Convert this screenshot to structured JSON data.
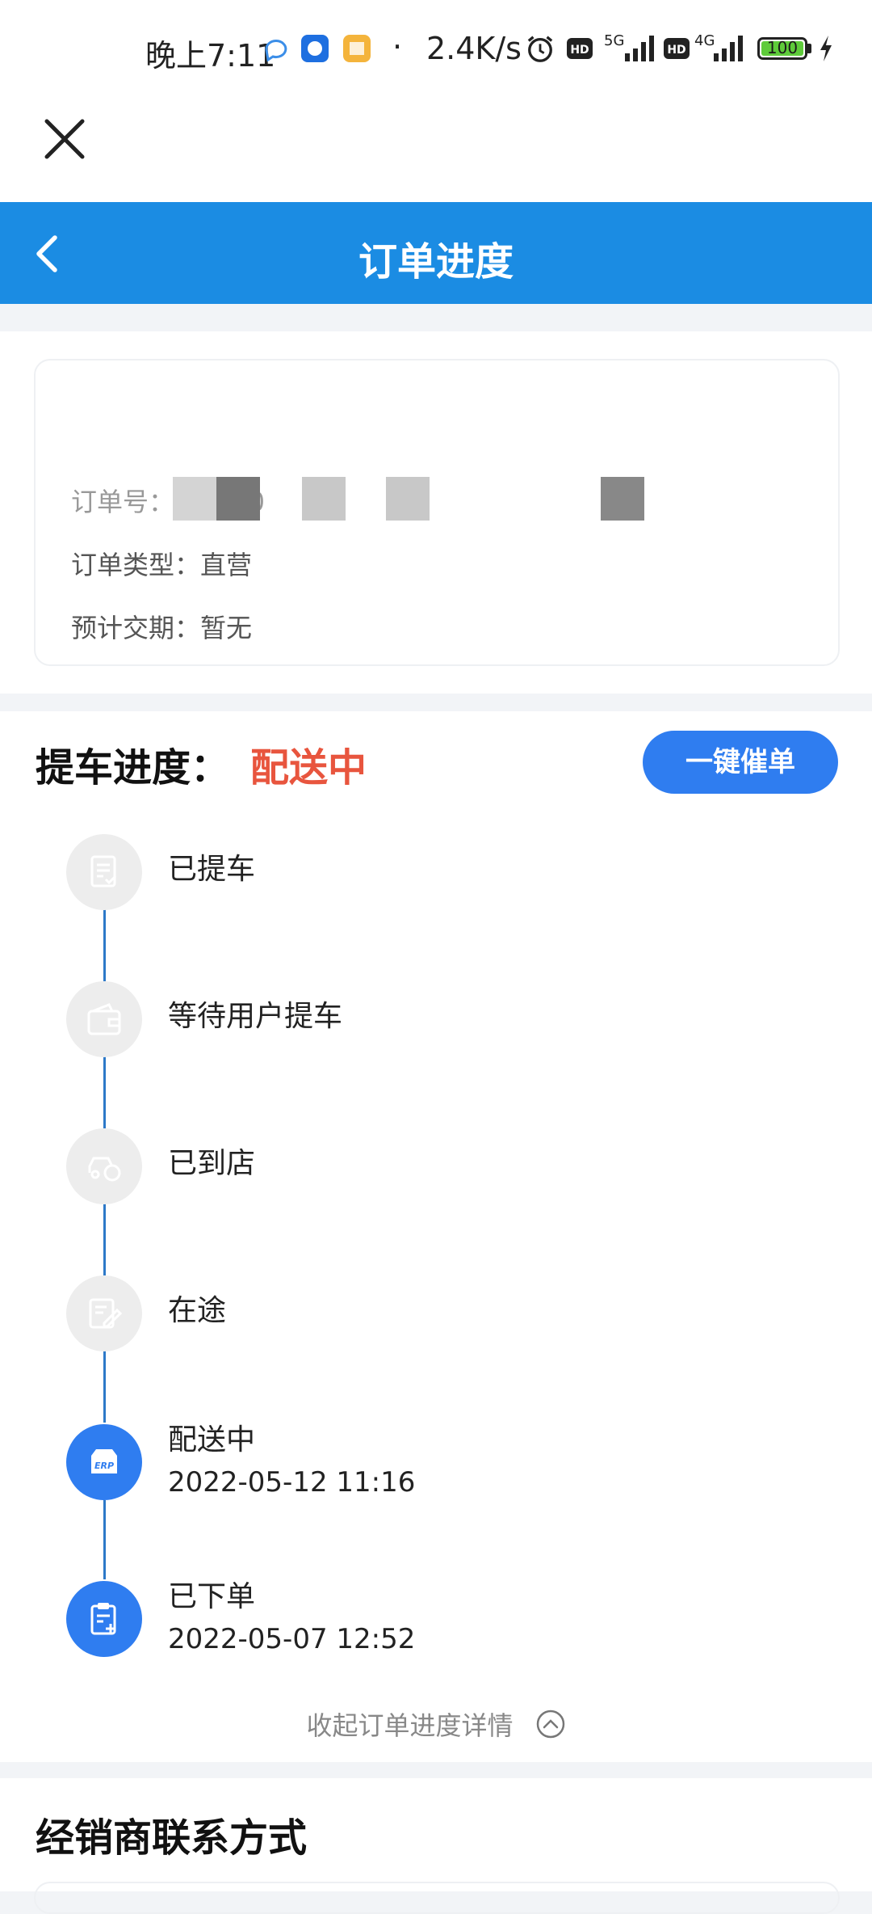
{
  "status_bar": {
    "time": "晚上7:11",
    "speed": "2.4K/s",
    "net1": "5G",
    "net2": "4G",
    "hd": "HD",
    "battery": "100"
  },
  "header": {
    "title": "订单进度"
  },
  "order_info": {
    "order_no_partial": "订单号：  10160",
    "order_type": "订单类型：直营",
    "delivery_date": "预计交期：暂无"
  },
  "progress": {
    "label": "提车进度：",
    "status": "配送中",
    "urge_button": "一键催单",
    "steps": [
      {
        "label": "已提车",
        "time": "",
        "active": false,
        "icon": "document-check-icon"
      },
      {
        "label": "等待用户提车",
        "time": "",
        "active": false,
        "icon": "wallet-icon"
      },
      {
        "label": "已到店",
        "time": "",
        "active": false,
        "icon": "car-arrive-icon"
      },
      {
        "label": "在途",
        "time": "",
        "active": false,
        "icon": "edit-doc-icon"
      },
      {
        "label": "配送中",
        "time": "2022-05-12 11:16",
        "active": true,
        "icon": "erp-box-icon"
      },
      {
        "label": "已下单",
        "time": "2022-05-07 12:52",
        "active": true,
        "icon": "clipboard-add-icon"
      }
    ],
    "collapse_text": "收起订单进度详情"
  },
  "dealer": {
    "title": "经销商联系方式"
  },
  "colors": {
    "header_bg": "#1b8ce3",
    "accent": "#2f7df0",
    "status_red": "#e8553e"
  }
}
